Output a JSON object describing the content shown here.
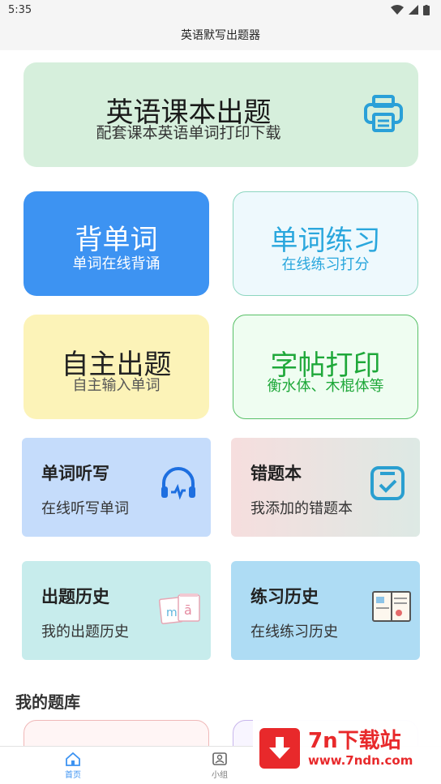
{
  "status": {
    "time": "5:35"
  },
  "appbar": {
    "title": "英语默写出题器"
  },
  "print_card": {
    "title": "英语课本出题",
    "subtitle": "配套课本英语单词打印下载"
  },
  "memorize_card": {
    "title": "背单词",
    "subtitle": "单词在线背诵"
  },
  "practice_card": {
    "title": "单词练习",
    "subtitle": "在线练习打分"
  },
  "self_card": {
    "title": "自主出题",
    "subtitle": "自主输入单词"
  },
  "copybook_card": {
    "title": "字帖打印",
    "subtitle": "衡水体、木棍体等"
  },
  "dictation_card": {
    "title": "单词听写",
    "subtitle": "在线听写单词"
  },
  "wrong_card": {
    "title": "错题本",
    "subtitle": "我添加的错题本"
  },
  "question_history_card": {
    "title": "出题历史",
    "subtitle": "我的出题历史"
  },
  "practice_history_card": {
    "title": "练习历史",
    "subtitle": "在线练习历史"
  },
  "bank_section": {
    "title": "我的题库"
  },
  "bottom_nav": {
    "home": "首页",
    "group": "小组"
  },
  "watermark": {
    "main": "7n下载站",
    "url": "www.7ndn.com"
  },
  "colors": {
    "primary": "#3d93f2",
    "green": "#1fa83a",
    "cyan": "#2aa7dd",
    "red": "#e8292b"
  }
}
